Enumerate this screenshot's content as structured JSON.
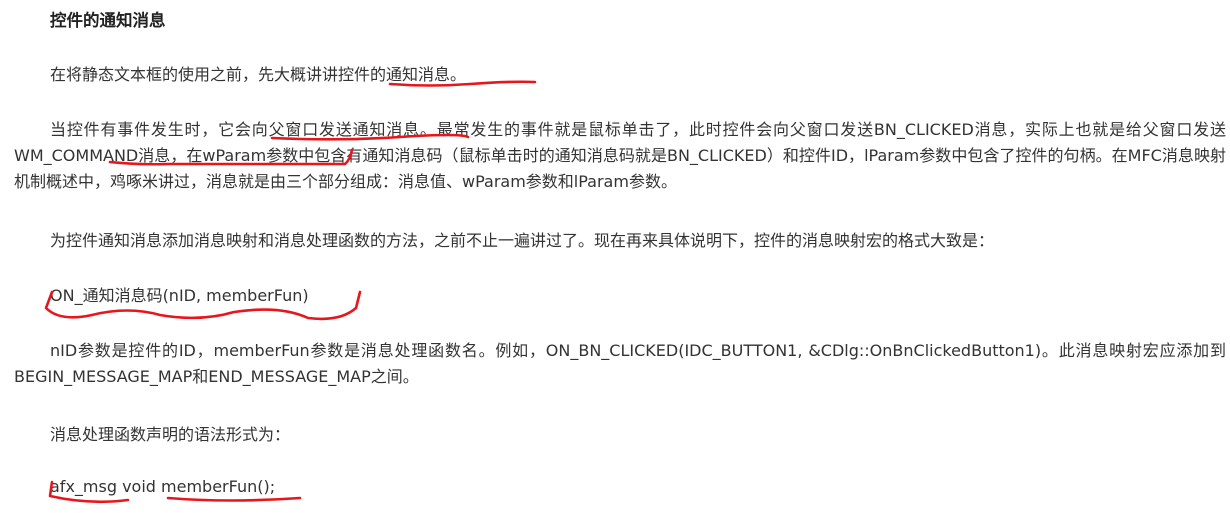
{
  "heading": "控件的通知消息",
  "p1": {
    "before": "在将静态文本框的使用之前，先大概讲讲",
    "marked": "控件的通知消息。"
  },
  "p2": {
    "s1": "当控件有事件发生时，它会",
    "m1": "向父窗口发送通知消息",
    "s2": "。最常发生的事件就是鼠标单击了，此时控件会向父窗口发送BN_CLICKED消息，实际上也就是给父窗口发送",
    "m2": "WM_COMMAND消息",
    "s3": "，在wParam参数中包含有通知消息码（鼠标单击时的通知消息码就是BN_CLICKED）和控件ID，lParam参数中包含了控件的句柄。在MFC消息映射机制概述中，鸡啄米讲过，消息就是由三个部分组成：消息值、wParam参数和lParam参数。"
  },
  "p3": "为控件通知消息添加消息映射和消息处理函数的方法，之前不止一遍讲过了。现在再来具体说明下，控件的消息映射宏的格式大致是：",
  "p4": "ON_通知消息码(nID, memberFun)",
  "p5": "nID参数是控件的ID，memberFun参数是消息处理函数名。例如，ON_BN_CLICKED(IDC_BUTTON1, &CDlg::OnBnClickedButton1)。此消息映射宏应添加到BEGIN_MESSAGE_MAP和END_MESSAGE_MAP之间。",
  "p6": "消息处理函数声明的语法形式为：",
  "p7": {
    "part1": "afx_msg",
    "part2": " void ",
    "part3": "memberFun();"
  },
  "colors": {
    "text": "#333333",
    "annotation": "#e8161c",
    "background": "#ffffff"
  }
}
